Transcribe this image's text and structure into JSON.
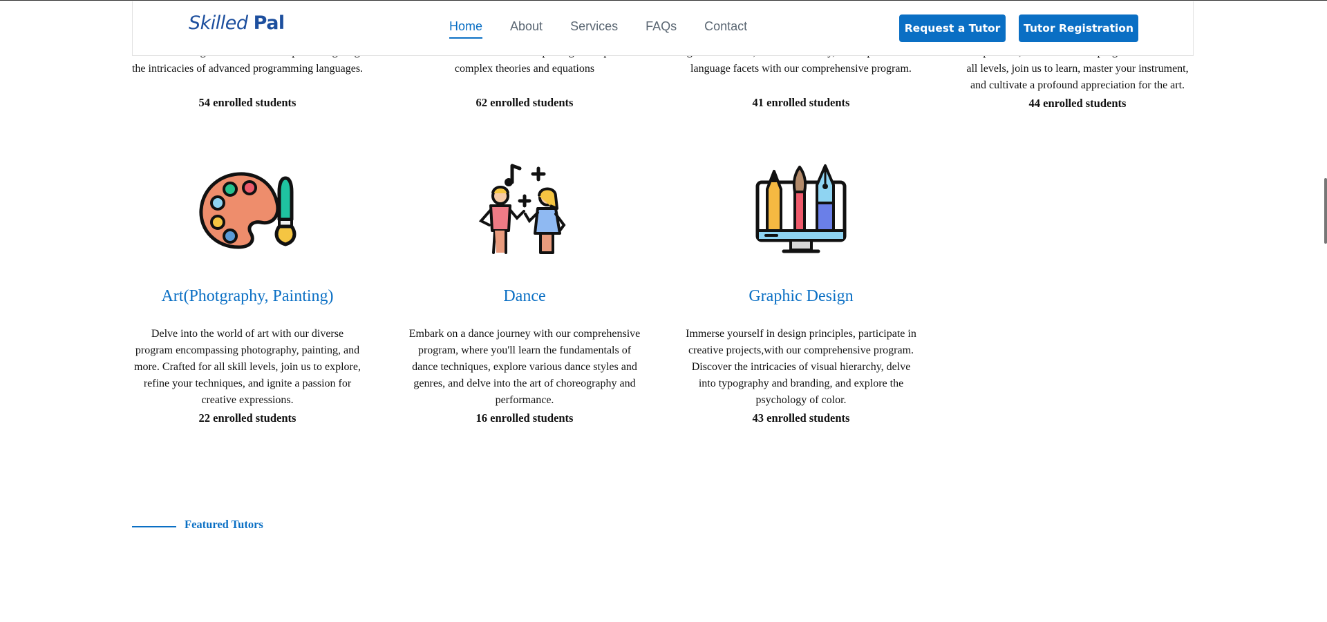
{
  "header": {
    "logo_part1": "Skilled",
    "logo_part2": "Pal",
    "nav": [
      "Home",
      "About",
      "Services",
      "FAQs",
      "Contact"
    ],
    "active_nav": "Home",
    "request_button": "Request a Tutor",
    "register_button": "Tutor Registration"
  },
  "top_row": [
    {
      "desc_line1": "world of coding to seasoned developers navigating",
      "desc_line2": "the intricacies of advanced programming languages.",
      "count": "54 enrolled students"
    },
    {
      "desc_line1": "advanced mathematicians exploring the depths of",
      "desc_line2": "complex theories and equations",
      "count": "62 enrolled students"
    },
    {
      "desc_line1": "grammar skills, build vocabulary, and explore other",
      "desc_line2": "language facets with our comprehensive program.",
      "count": "41 enrolled students"
    },
    {
      "desc_line1": "composition, and more in our program. Curated for",
      "desc_line2": "all levels, join us to learn, master your instrument,",
      "desc_line3": "and cultivate a profound appreciation for the art.",
      "count": "44 enrolled students"
    }
  ],
  "courses": [
    {
      "icon": "art-palette-icon",
      "title": "Art(Photgraphy, Painting)",
      "description": "Delve into the world of art with our diverse program encompassing photography, painting, and more. Crafted for all skill levels, join us to explore, refine your techniques, and ignite a passion for creative expressions.",
      "count": "22 enrolled students"
    },
    {
      "icon": "dance-icon",
      "title": "Dance",
      "description": "Embark on a dance journey with our comprehensive program, where you'll learn the fundamentals of dance techniques, explore various dance styles and genres, and delve into the art of choreography and performance.",
      "count": "16 enrolled students"
    },
    {
      "icon": "graphic-design-icon",
      "title": "Graphic Design",
      "description": "Immerse yourself in design principles, participate in creative projects,with our comprehensive program. Discover the intricacies of visual hierarchy, delve into typography and branding, and explore the psychology of color.",
      "count": "43 enrolled students"
    }
  ],
  "featured": {
    "label": "Featured Tutors"
  },
  "colors": {
    "accent": "#0a6fc4",
    "logo": "#1d4f9e",
    "nav_text": "#5a6672"
  }
}
